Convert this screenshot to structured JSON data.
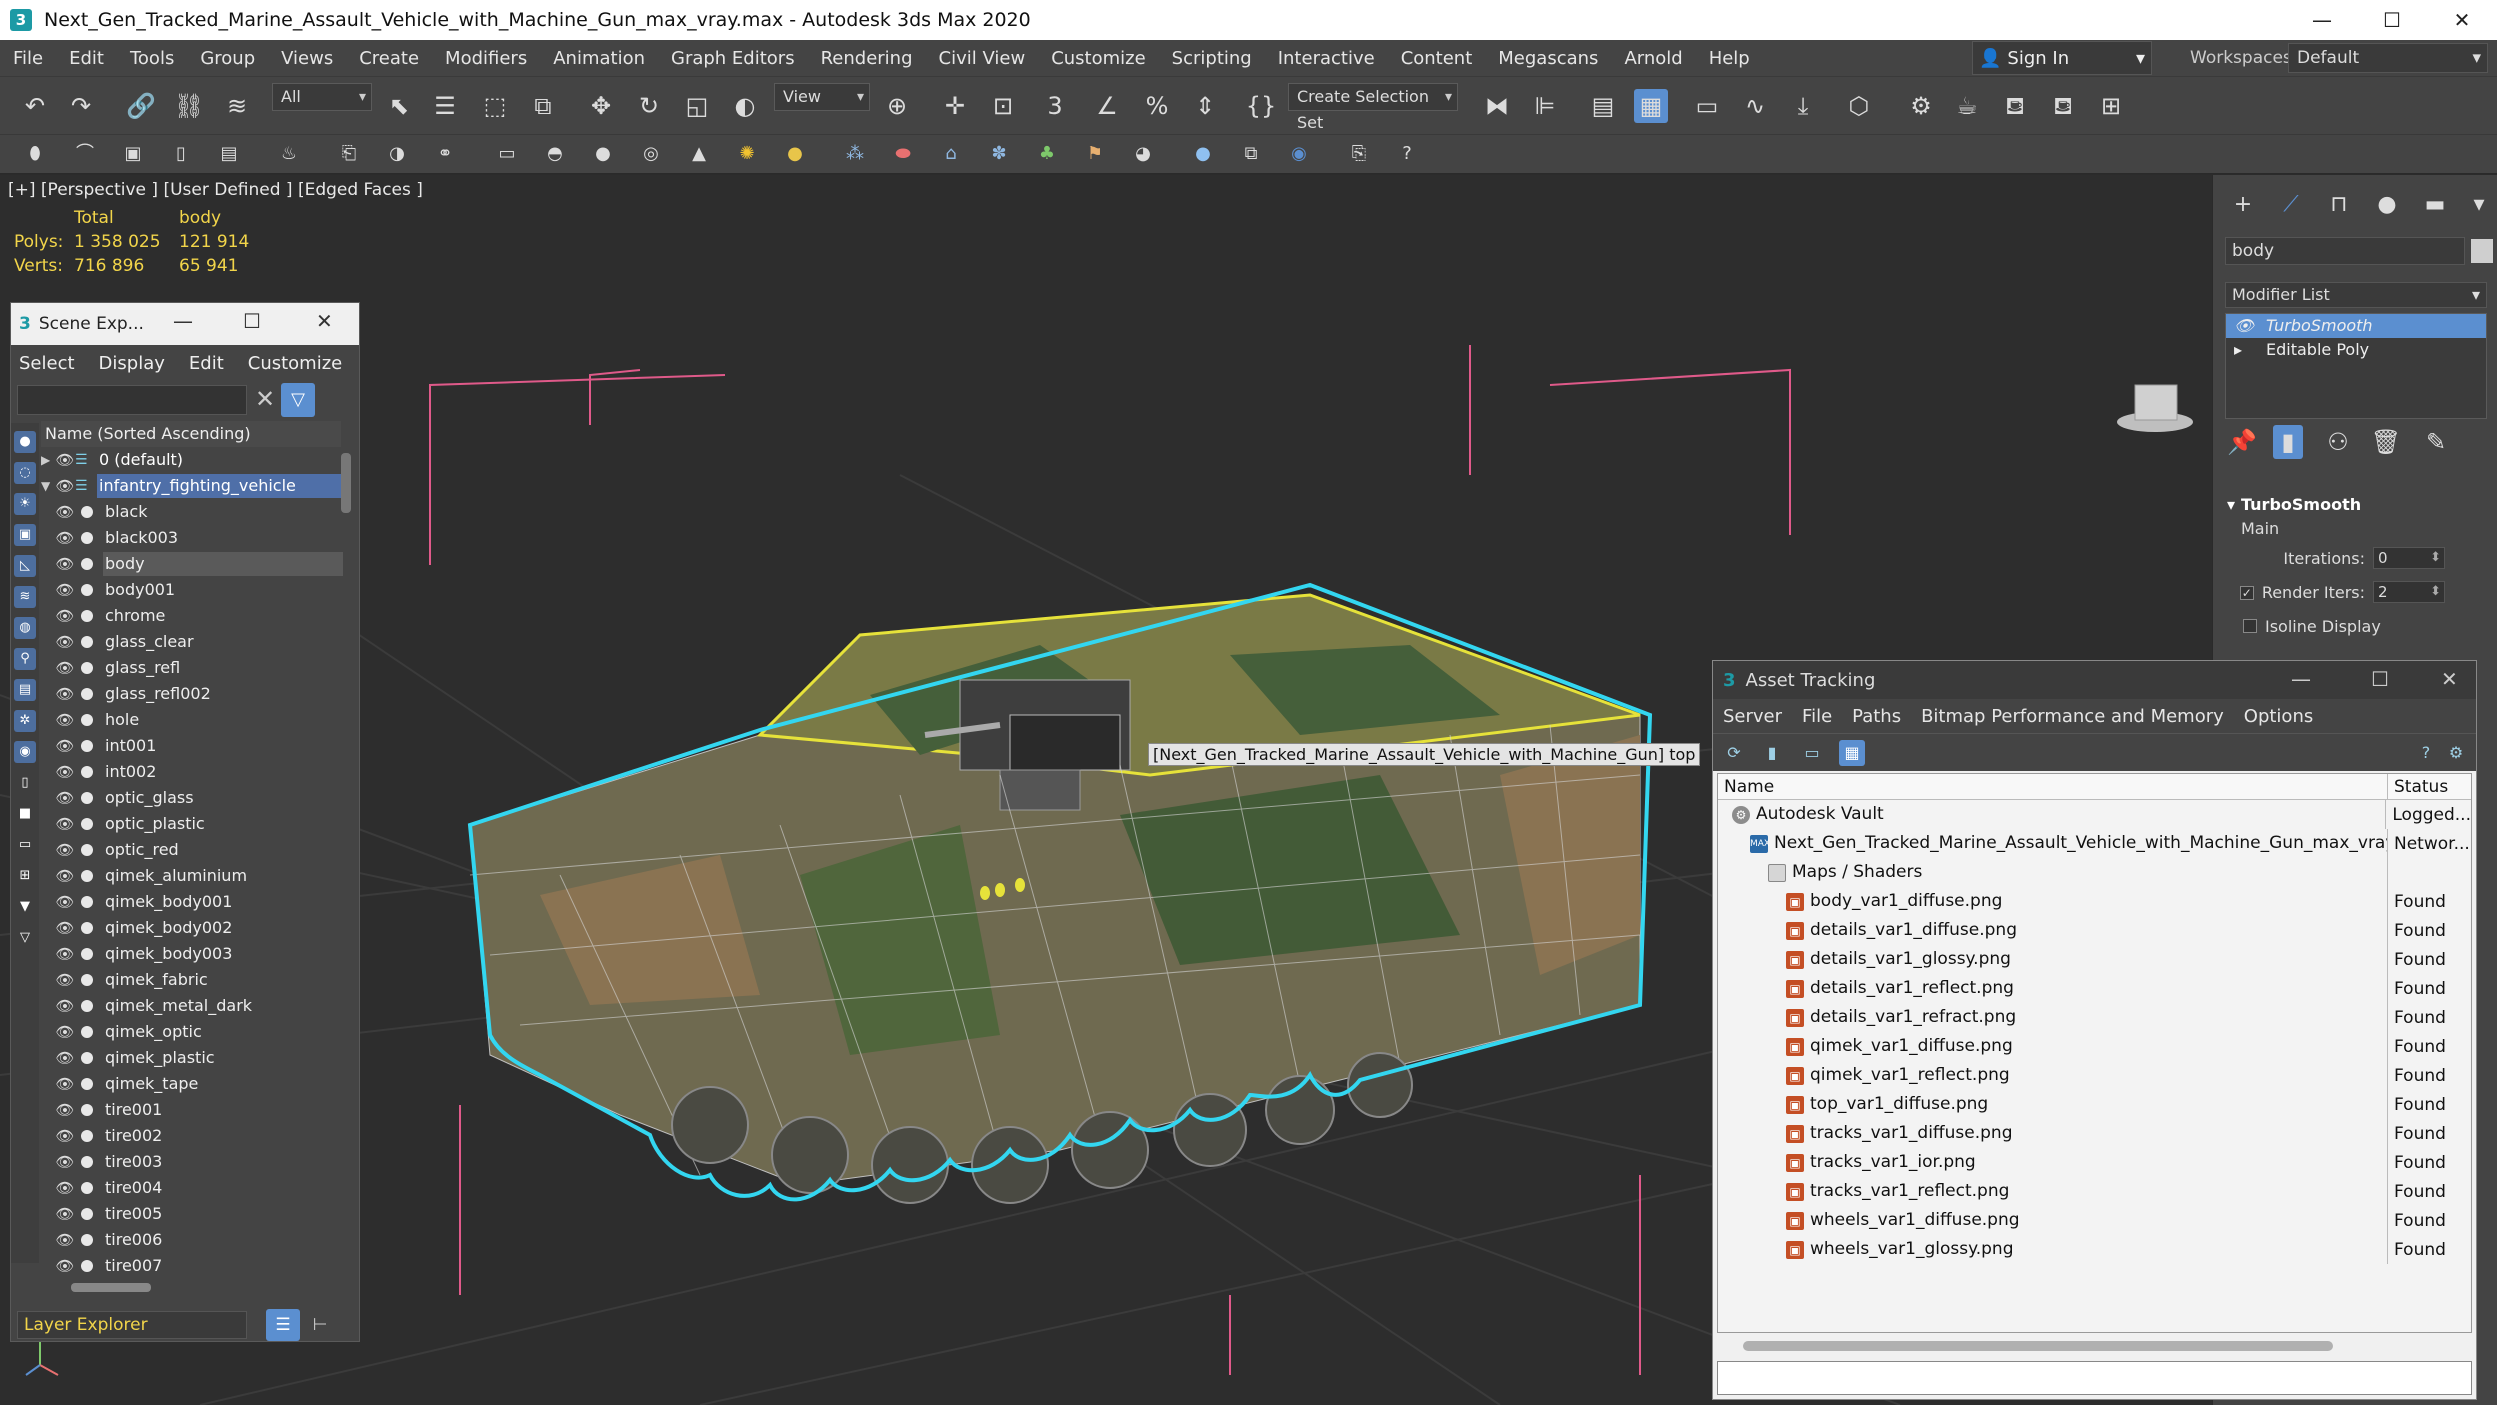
{
  "window": {
    "title": "Next_Gen_Tracked_Marine_Assault_Vehicle_with_Machine_Gun_max_vray.max - Autodesk 3ds Max 2020",
    "app_icon": "3"
  },
  "menubar": {
    "items": [
      "File",
      "Edit",
      "Tools",
      "Group",
      "Views",
      "Create",
      "Modifiers",
      "Animation",
      "Graph Editors",
      "Rendering",
      "Civil View",
      "Customize",
      "Scripting",
      "Interactive",
      "Content",
      "Megascans",
      "Arnold",
      "Help"
    ],
    "signin": "Sign In",
    "workspaces_label": "Workspaces:",
    "workspaces_value": "Default"
  },
  "toolbar": {
    "filter_value": "All",
    "refcoord_value": "View",
    "selection_set_placeholder": "Create Selection Set"
  },
  "viewport": {
    "label": "[+] [Perspective ] [User Defined ] [Edged Faces ]",
    "stats": {
      "header_total": "Total",
      "header_object": "body",
      "polys_label": "Polys:",
      "polys_total": "1 358 025",
      "polys_object": "121 914",
      "verts_label": "Verts:",
      "verts_total": "716 896",
      "verts_object": "65 941"
    },
    "tooltip": "[Next_Gen_Tracked_Marine_Assault_Vehicle_with_Machine_Gun] top"
  },
  "scene_explorer": {
    "title": "Scene Exp...",
    "menu": [
      "Select",
      "Display",
      "Edit",
      "Customize"
    ],
    "column_header": "Name (Sorted Ascending)",
    "rows": [
      {
        "name": "0 (default)",
        "type": "layer",
        "state": ""
      },
      {
        "name": "infantry_fighting_vehicle",
        "type": "layer",
        "state": "highlight"
      },
      {
        "name": "black",
        "type": "object",
        "state": ""
      },
      {
        "name": "black003",
        "type": "object",
        "state": ""
      },
      {
        "name": "body",
        "type": "object",
        "state": "selected"
      },
      {
        "name": "body001",
        "type": "object",
        "state": ""
      },
      {
        "name": "chrome",
        "type": "object",
        "state": ""
      },
      {
        "name": "glass_clear",
        "type": "object",
        "state": ""
      },
      {
        "name": "glass_refl",
        "type": "object",
        "state": ""
      },
      {
        "name": "glass_refl002",
        "type": "object",
        "state": ""
      },
      {
        "name": "hole",
        "type": "object",
        "state": ""
      },
      {
        "name": "int001",
        "type": "object",
        "state": ""
      },
      {
        "name": "int002",
        "type": "object",
        "state": ""
      },
      {
        "name": "optic_glass",
        "type": "object",
        "state": ""
      },
      {
        "name": "optic_plastic",
        "type": "object",
        "state": ""
      },
      {
        "name": "optic_red",
        "type": "object",
        "state": ""
      },
      {
        "name": "qimek_aluminium",
        "type": "object",
        "state": ""
      },
      {
        "name": "qimek_body001",
        "type": "object",
        "state": ""
      },
      {
        "name": "qimek_body002",
        "type": "object",
        "state": ""
      },
      {
        "name": "qimek_body003",
        "type": "object",
        "state": ""
      },
      {
        "name": "qimek_fabric",
        "type": "object",
        "state": ""
      },
      {
        "name": "qimek_metal_dark",
        "type": "object",
        "state": ""
      },
      {
        "name": "qimek_optic",
        "type": "object",
        "state": ""
      },
      {
        "name": "qimek_plastic",
        "type": "object",
        "state": ""
      },
      {
        "name": "qimek_tape",
        "type": "object",
        "state": ""
      },
      {
        "name": "tire001",
        "type": "object",
        "state": ""
      },
      {
        "name": "tire002",
        "type": "object",
        "state": ""
      },
      {
        "name": "tire003",
        "type": "object",
        "state": ""
      },
      {
        "name": "tire004",
        "type": "object",
        "state": ""
      },
      {
        "name": "tire005",
        "type": "object",
        "state": ""
      },
      {
        "name": "tire006",
        "type": "object",
        "state": ""
      },
      {
        "name": "tire007",
        "type": "object",
        "state": ""
      }
    ],
    "footer": "Layer Explorer"
  },
  "command_panel": {
    "object_name": "body",
    "modifier_list": "Modifier List",
    "stack": [
      {
        "name": "TurboSmooth",
        "active": true
      },
      {
        "name": "Editable Poly",
        "active": false
      }
    ],
    "rollout_title": "TurboSmooth",
    "rollout_section": "Main",
    "iterations_label": "Iterations:",
    "iterations_value": "0",
    "render_iters_label": "Render Iters:",
    "render_iters_value": "2",
    "isoline_label": "Isoline Display"
  },
  "asset_tracking": {
    "title": "Asset Tracking",
    "menu": [
      "Server",
      "File",
      "Paths",
      "Bitmap Performance and Memory",
      "Options"
    ],
    "col_name": "Name",
    "col_status": "Status",
    "rows": [
      {
        "name": "Autodesk Vault",
        "status": "Logged...",
        "icon": "vault",
        "indent": 0
      },
      {
        "name": "Next_Gen_Tracked_Marine_Assault_Vehicle_with_Machine_Gun_max_vray.max",
        "status": "Networ...",
        "icon": "max",
        "indent": 1
      },
      {
        "name": "Maps / Shaders",
        "status": "",
        "icon": "folder",
        "indent": 2
      },
      {
        "name": "body_var1_diffuse.png",
        "status": "Found",
        "icon": "png",
        "indent": 3
      },
      {
        "name": "details_var1_diffuse.png",
        "status": "Found",
        "icon": "png",
        "indent": 3
      },
      {
        "name": "details_var1_glossy.png",
        "status": "Found",
        "icon": "png",
        "indent": 3
      },
      {
        "name": "details_var1_reflect.png",
        "status": "Found",
        "icon": "png",
        "indent": 3
      },
      {
        "name": "details_var1_refract.png",
        "status": "Found",
        "icon": "png",
        "indent": 3
      },
      {
        "name": "qimek_var1_diffuse.png",
        "status": "Found",
        "icon": "png",
        "indent": 3
      },
      {
        "name": "qimek_var1_reflect.png",
        "status": "Found",
        "icon": "png",
        "indent": 3
      },
      {
        "name": "top_var1_diffuse.png",
        "status": "Found",
        "icon": "png",
        "indent": 3
      },
      {
        "name": "tracks_var1_diffuse.png",
        "status": "Found",
        "icon": "png",
        "indent": 3
      },
      {
        "name": "tracks_var1_ior.png",
        "status": "Found",
        "icon": "png",
        "indent": 3
      },
      {
        "name": "tracks_var1_reflect.png",
        "status": "Found",
        "icon": "png",
        "indent": 3
      },
      {
        "name": "wheels_var1_diffuse.png",
        "status": "Found",
        "icon": "png",
        "indent": 3
      },
      {
        "name": "wheels_var1_glossy.png",
        "status": "Found",
        "icon": "png",
        "indent": 3
      }
    ]
  },
  "colors": {
    "accent": "#5b8fd0",
    "stats_text": "#f2d54a",
    "selection_outline": "#33d6f0",
    "bounding_box": "#e05a8a"
  }
}
